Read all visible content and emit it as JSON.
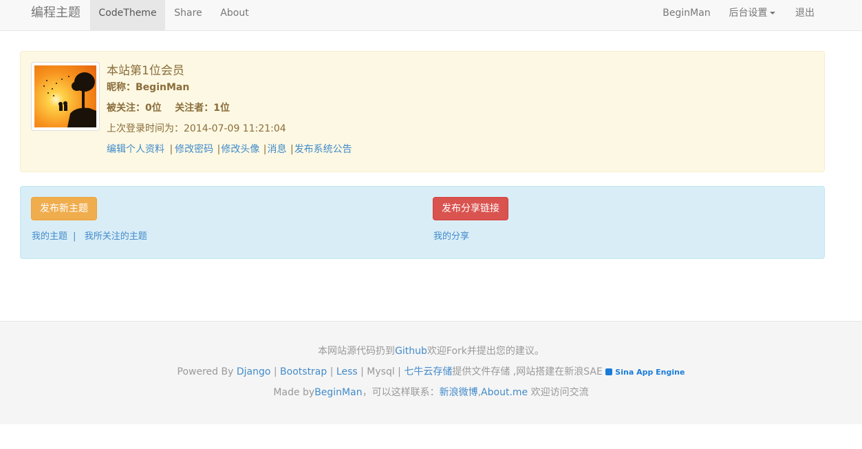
{
  "navbar": {
    "brand": "编程主题",
    "items": [
      "CodeTheme",
      "Share",
      "About"
    ],
    "active_item": "CodeTheme",
    "user": "BeginMan",
    "admin_label": "后台设置",
    "logout": "退出"
  },
  "profile": {
    "title": "本站第1位会员",
    "nickname_label": "昵称：",
    "nickname": "BeginMan",
    "followers": "被关注：0位",
    "following": "关注者：1位",
    "last_login_label": "上次登录时间为：",
    "last_login": "2014-07-09 11:21:04",
    "links": [
      "编辑个人资料",
      "修改密码",
      "修改头像",
      "消息",
      "发布系统公告"
    ]
  },
  "actions": {
    "new_topic_button": "发布新主题",
    "my_topics": "我的主题",
    "followed_topics": "我所关注的主题",
    "share_link_button": "发布分享链接",
    "my_shares": "我的分享"
  },
  "footer": {
    "line1_pre": "本网站源代码扔到",
    "line1_link": "Github",
    "line1_post": "欢迎Fork并提出您的建议。",
    "powered_by": "Powered By ",
    "django": "Django",
    "bootstrap": "Bootstrap",
    "less": "Less",
    "mysql": "Mysql",
    "qiniu": "七牛云存储",
    "storage_text": "提供文件存储 ,网站搭建在新浪SAE",
    "sae_badge": "Sina  App Engine",
    "made_by": "Made by",
    "author": "BeginMan",
    "contact_text": "，可以这样联系：",
    "weibo": "新浪微博",
    "comma": ",",
    "aboutme": "About.me",
    "welcome": " 欢迎访问交流"
  },
  "colors": {
    "warning_panel": "#fcf8e3",
    "info_panel": "#d9edf7",
    "link": "#428bca",
    "warning_button": "#f0ad4e",
    "danger_button": "#d9534f"
  }
}
